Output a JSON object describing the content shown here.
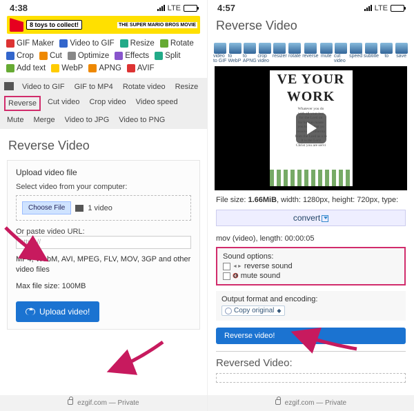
{
  "left": {
    "status": {
      "time": "4:38",
      "net": "LTE"
    },
    "banner": {
      "text": "8 toys to collect!",
      "brand": "THE SUPER MARIO BROS MOVIE"
    },
    "tools": [
      "GIF Maker",
      "Video to GIF",
      "Resize",
      "Rotate",
      "Crop",
      "Cut",
      "Optimize",
      "Effects",
      "Split",
      "Add text",
      "WebP",
      "APNG",
      "AVIF"
    ],
    "subtabs": [
      "Video to GIF",
      "GIF to MP4",
      "Rotate video",
      "Resize",
      "Reverse",
      "Cut video",
      "Crop video",
      "Video speed",
      "Mute",
      "Merge",
      "Video to JPG",
      "Video to PNG"
    ],
    "subtabs_selected": "Reverse",
    "heading": "Reverse Video",
    "card": {
      "title": "Upload video file",
      "select_label": "Select video from your computer:",
      "choose_btn": "Choose File",
      "file_chosen": "1 video",
      "or_label": "Or paste video URL:",
      "url_placeholder": "https://",
      "formats": "MP4, WebM, AVI, MPEG, FLV, MOV, 3GP and other video files",
      "max": "Max file size: 100MB",
      "upload_btn": "Upload video!"
    },
    "footer": {
      "site": "ezgif.com",
      "mode": "Private"
    }
  },
  "right": {
    "status": {
      "time": "4:57",
      "net": "LTE"
    },
    "heading": "Reverse Video",
    "toolstrip": [
      "video to GIF",
      "to WebP",
      "to APNG",
      "crop video",
      "resizer",
      "rotate",
      "reverse",
      "mute",
      "cut video",
      "speed",
      "subtitle",
      "to",
      "save"
    ],
    "poster": {
      "line1": "VE YOUR",
      "line2": "WORK",
      "small": "Whatever you do\nwith all your hea\nfor the Lord rat\nfor human maste\nyou know that yo\nreceive an inherita\nfrom the Lord as a re\nIt is the Lord\nChrist you are servi"
    },
    "meta1_a": "File size: ",
    "meta1_b": "1.66MiB",
    "meta1_c": ", width: 1280px, height: 720px, type:",
    "convert": "convert",
    "meta2": "mov (video), length: 00:00:05",
    "sound": {
      "title": "Sound options:",
      "opt1": "reverse sound",
      "opt2": "mute sound"
    },
    "encode": {
      "title": "Output format and encoding:",
      "value": "Copy original"
    },
    "reverse_btn": "Reverse video!",
    "out_heading": "Reversed Video:",
    "footer": {
      "site": "ezgif.com",
      "mode": "Private"
    }
  }
}
